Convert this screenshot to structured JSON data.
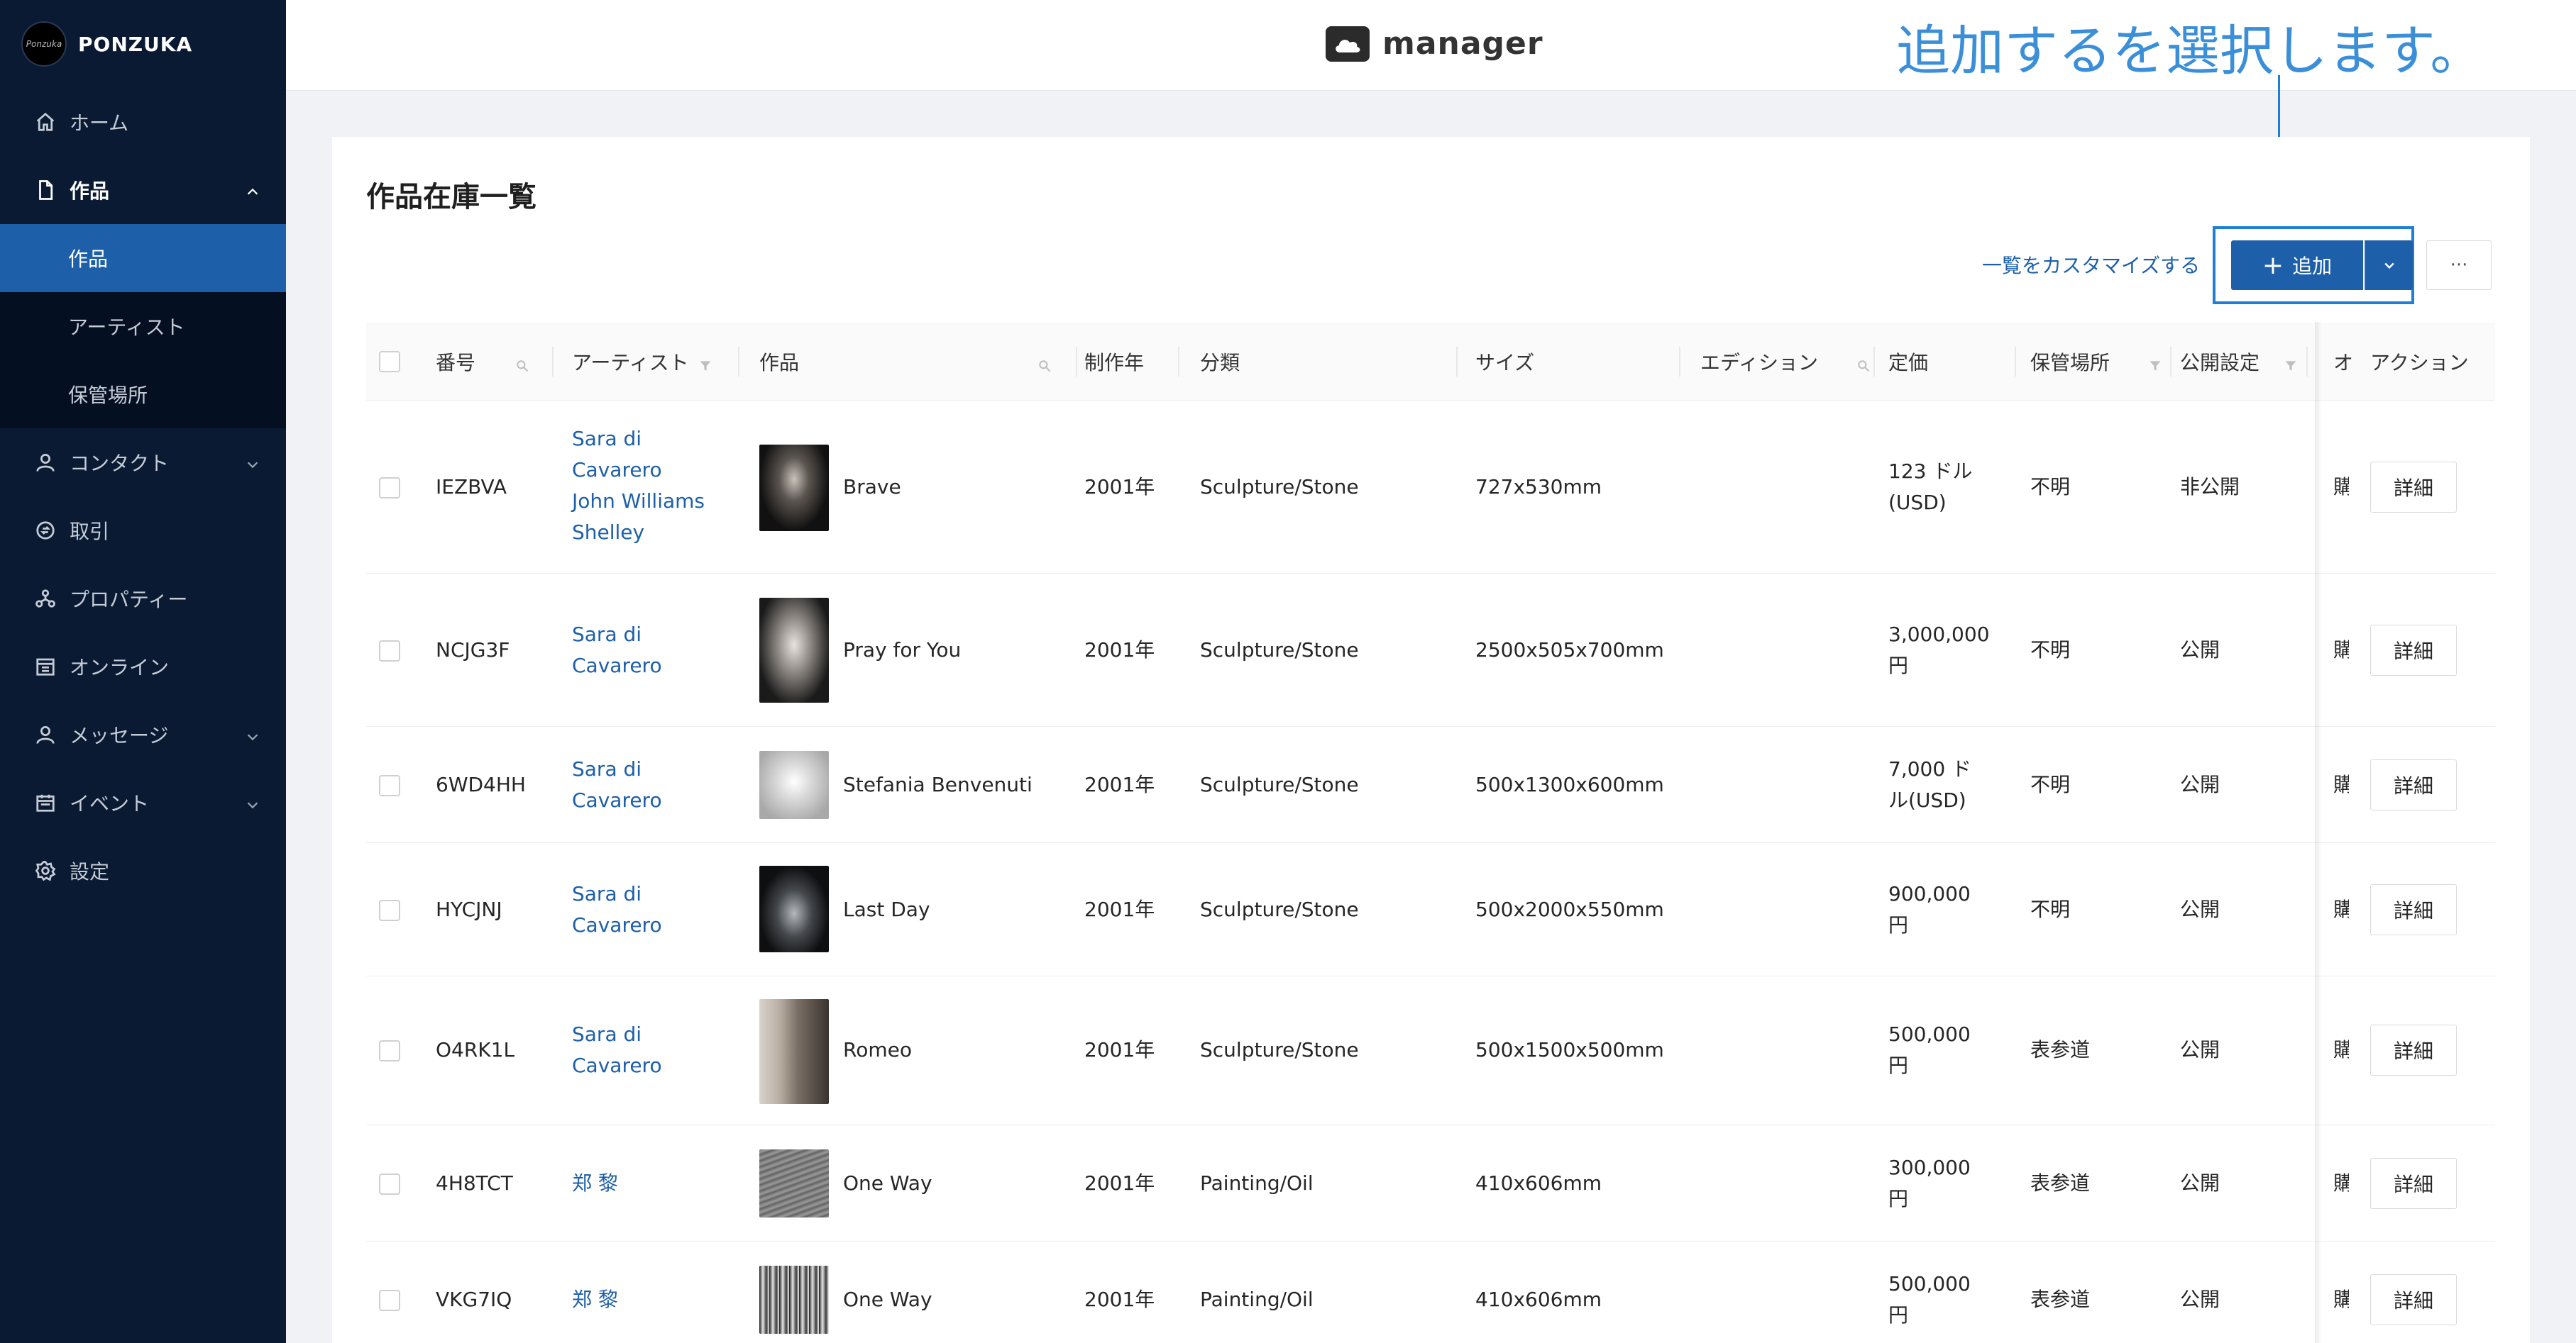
{
  "sidebar": {
    "brand": "PONZUKA",
    "brand_logo_text": "Ponzuka",
    "items": [
      {
        "label": "ホーム"
      },
      {
        "label": "作品"
      },
      {
        "label": "作品"
      },
      {
        "label": "アーティスト"
      },
      {
        "label": "保管場所"
      },
      {
        "label": "コンタクト"
      },
      {
        "label": "取引"
      },
      {
        "label": "プロパティー"
      },
      {
        "label": "オンライン"
      },
      {
        "label": "メッセージ"
      },
      {
        "label": "イベント"
      },
      {
        "label": "設定"
      }
    ]
  },
  "header": {
    "title": "manager"
  },
  "annotation": {
    "text": "追加するを選択します。",
    "color": "#3b8fd8"
  },
  "page": {
    "title": "作品在庫一覧",
    "customize_link": "一覧をカスタマイズする",
    "add_label": "追加",
    "more_label": "···"
  },
  "table": {
    "columns": [
      "番号",
      "アーティスト",
      "作品",
      "制作年",
      "分類",
      "サイズ",
      "エディション",
      "定価",
      "保管場所",
      "公開設定",
      "オ",
      "アクション"
    ],
    "rows": [
      {
        "id": "IEZBVA",
        "artist": [
          "Sara di",
          "Cavarero",
          "John Williams",
          "Shelley"
        ],
        "work": "Brave",
        "year": "2001年",
        "category": "Sculpture/Stone",
        "size": "727x530mm",
        "price": [
          "123 ドル",
          "(USD)"
        ],
        "location": "不明",
        "visibility": "非公開",
        "extra": "購",
        "action": "詳細"
      },
      {
        "id": "NCJG3F",
        "artist": [
          "Sara di",
          "Cavarero"
        ],
        "work": "Pray for You",
        "year": "2001年",
        "category": "Sculpture/Stone",
        "size": "2500x505x700mm",
        "price": [
          "3,000,000",
          "円"
        ],
        "location": "不明",
        "visibility": "公開",
        "extra": "購",
        "action": "詳細"
      },
      {
        "id": "6WD4HH",
        "artist": [
          "Sara di",
          "Cavarero"
        ],
        "work": "Stefania Benvenuti",
        "year": "2001年",
        "category": "Sculpture/Stone",
        "size": "500x1300x600mm",
        "price": [
          "7,000 ド",
          "ル(USD)"
        ],
        "location": "不明",
        "visibility": "公開",
        "extra": "購",
        "action": "詳細"
      },
      {
        "id": "HYCJNJ",
        "artist": [
          "Sara di",
          "Cavarero"
        ],
        "work": "Last Day",
        "year": "2001年",
        "category": "Sculpture/Stone",
        "size": "500x2000x550mm",
        "price": [
          "900,000",
          "円"
        ],
        "location": "不明",
        "visibility": "公開",
        "extra": "購",
        "action": "詳細"
      },
      {
        "id": "O4RK1L",
        "artist": [
          "Sara di",
          "Cavarero"
        ],
        "work": "Romeo",
        "year": "2001年",
        "category": "Sculpture/Stone",
        "size": "500x1500x500mm",
        "price": [
          "500,000",
          "円"
        ],
        "location": "表参道",
        "visibility": "公開",
        "extra": "購",
        "action": "詳細"
      },
      {
        "id": "4H8TCT",
        "artist": [
          "郑 黎"
        ],
        "work": "One Way",
        "year": "2001年",
        "category": "Painting/Oil",
        "size": "410x606mm",
        "price": [
          "300,000",
          "円"
        ],
        "location": "表参道",
        "visibility": "公開",
        "extra": "購",
        "action": "詳細"
      },
      {
        "id": "VKG7IQ",
        "artist": [
          "郑 黎"
        ],
        "work": "One Way",
        "year": "2001年",
        "category": "Painting/Oil",
        "size": "410x606mm",
        "price": [
          "500,000",
          "円"
        ],
        "location": "表参道",
        "visibility": "公開",
        "extra": "購",
        "action": "詳細"
      }
    ]
  },
  "colors": {
    "sidebar_bg": "#0a1a33",
    "active_item": "#1d5fa8",
    "primary": "#1d5fa8",
    "highlight": "#1f7fd6"
  }
}
